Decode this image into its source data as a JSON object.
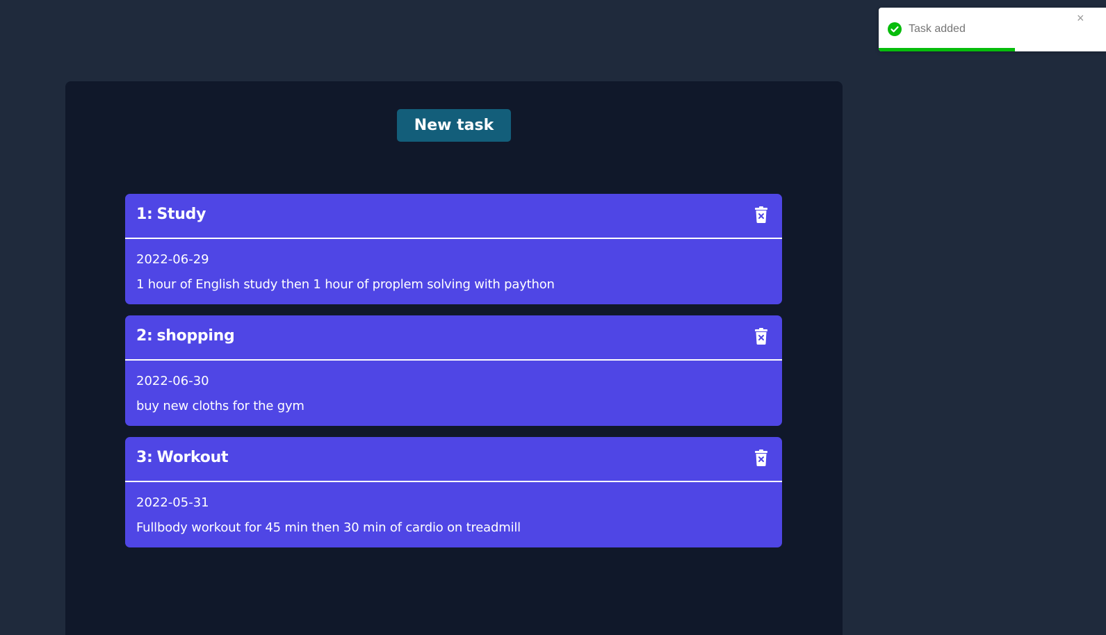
{
  "toast": {
    "message": "Task added",
    "close_glyph": "×",
    "icon": "check-circle-icon",
    "status_color": "#07bc0c",
    "progress_fraction": 0.6
  },
  "toolbar": {
    "new_task_label": "New task"
  },
  "tasks": [
    {
      "number": "1:",
      "title": "Study",
      "date": "2022-06-29",
      "description": "1 hour of English study then 1 hour of proplem solving with paython",
      "delete_icon": "trash-x-icon"
    },
    {
      "number": "2:",
      "title": "shopping",
      "date": "2022-06-30",
      "description": "buy new cloths for the gym",
      "delete_icon": "trash-x-icon"
    },
    {
      "number": "3:",
      "title": "Workout",
      "date": "2022-05-31",
      "description": "Fullbody workout for 45 min then 30 min of cardio on treadmill",
      "delete_icon": "trash-x-icon"
    }
  ],
  "colors": {
    "page_bg": "#1f2a3c",
    "panel_bg": "#10182a",
    "button_bg": "#135e7a",
    "card_bg": "#4f46e5"
  }
}
